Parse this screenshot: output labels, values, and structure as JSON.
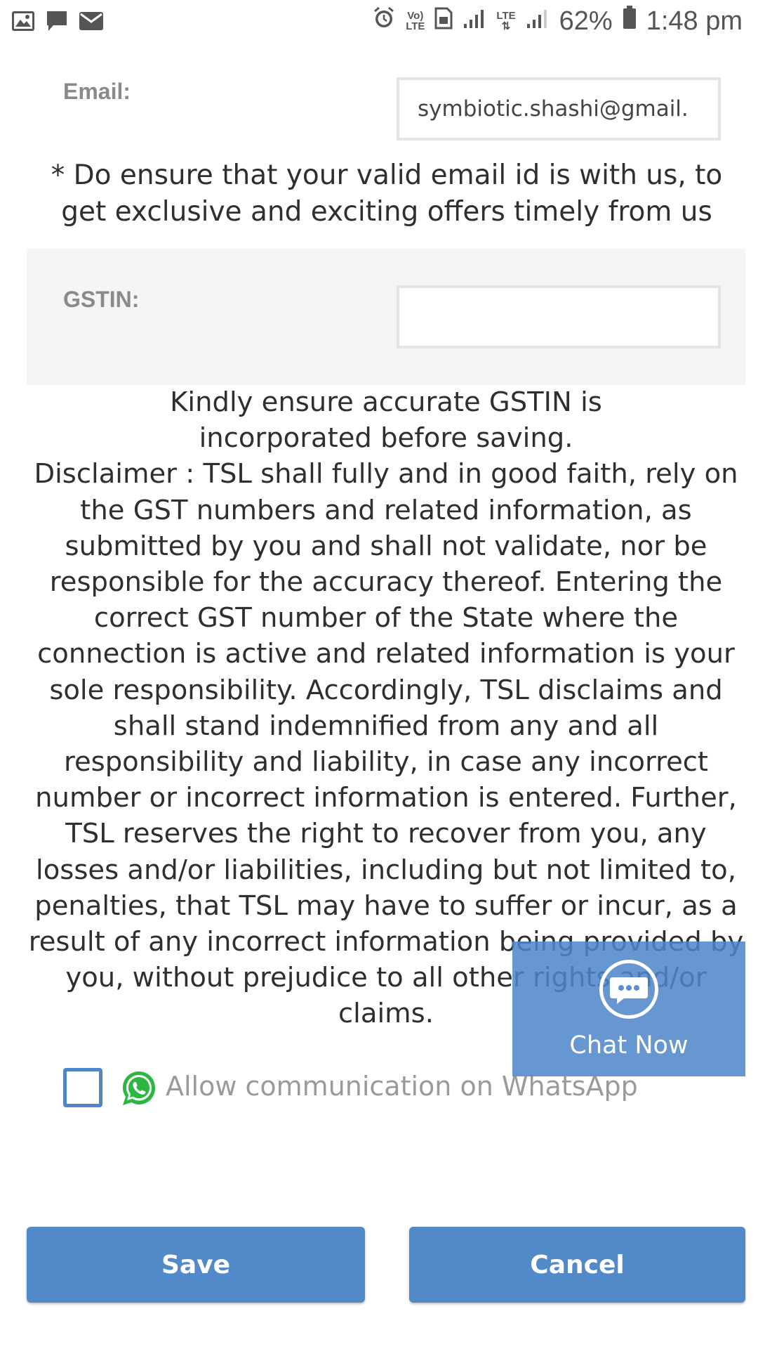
{
  "status_bar": {
    "battery": "62%",
    "time": "1:48 pm",
    "volte_label_1": "Vo)",
    "volte_label_2": "LTE",
    "lte_label": "LTE"
  },
  "form": {
    "email_label": "Email:",
    "email_value": "symbiotic.shashi@gmail.",
    "email_notice_line1": "* Do ensure that your valid email id is with us, to",
    "email_notice_line2": "get exclusive and exciting offers timely from us",
    "gstin_label": "GSTIN:",
    "gstin_value": "",
    "gstin_notice": "Kindly ensure accurate GSTIN is incorporated before saving.",
    "disclaimer": "Disclaimer : TSL shall fully and in good faith, rely on the GST numbers and related information, as submitted by you and shall not validate, nor be responsible for the accuracy thereof. Entering the correct GST number of the State where the connection is active and related information is your sole responsibility. Accordingly, TSL disclaims and shall stand indemnified from any and all responsibility and liability, in case any incorrect number or incorrect information is entered. Further, TSL reserves the right to recover from you, any losses and/or liabilities, including but not limited to, penalties, that TSL may have to suffer or incur, as a result of any incorrect information being provided by you, without prejudice to all other rights and/or claims.",
    "whatsapp_label": "Allow communication on WhatsApp",
    "whatsapp_checked": false
  },
  "chat_widget": {
    "label": "Chat Now"
  },
  "buttons": {
    "save": "Save",
    "cancel": "Cancel"
  },
  "colors": {
    "accent": "#5189c9",
    "checkbox_border": "#4e86c8",
    "whatsapp_green": "#2cb742"
  }
}
